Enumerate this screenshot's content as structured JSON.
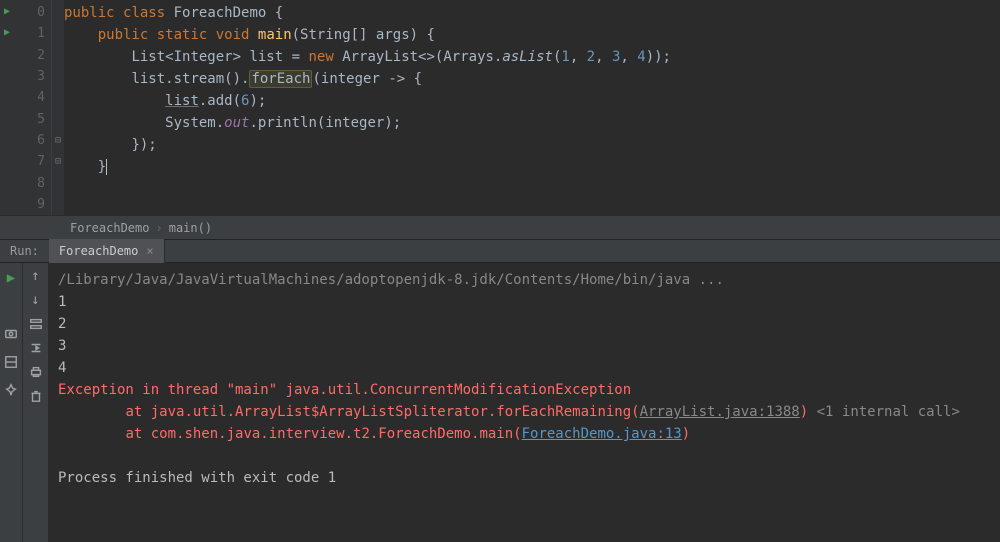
{
  "editor": {
    "lineNumbers": [
      "0",
      "1",
      "2",
      "3",
      "4",
      "5",
      "6",
      "7",
      "8",
      "9"
    ],
    "foldMarks": [
      "",
      "",
      "",
      "",
      "",
      "",
      "⊟",
      "⊟",
      "",
      ""
    ],
    "runMarkers": [
      true,
      true,
      false,
      false,
      false,
      false,
      false,
      false,
      false,
      false
    ]
  },
  "code": {
    "l0": {
      "kw1": "public",
      "kw2": "class",
      "name": "ForeachDemo",
      "brace": " {"
    },
    "l1": {
      "kw1": "public",
      "kw2": "static",
      "kw3": "void",
      "fn": "main",
      "params": "(String[] args) {"
    },
    "l2": {
      "type1": "List<Integer>",
      "var": "list",
      "assign": " = ",
      "kw": "new",
      "ctor": "ArrayList<>",
      "open": "(Arrays.",
      "asList": "asList",
      "args_open": "(",
      "n1": "1",
      "c": ", ",
      "n2": "2",
      "n3": "3",
      "n4": "4",
      "close": "));"
    },
    "l3": {
      "pre": "list.stream().",
      "box": "forEach",
      "post": "(integer -> {"
    },
    "l4": {
      "ul": "list",
      "call": ".add(",
      "n": "6",
      "post": ");"
    },
    "l5": {
      "pre": "System.",
      "it": "out",
      "call": ".println(integer);"
    },
    "l6": {
      "txt": "});"
    },
    "l7": {
      "txt": "}"
    }
  },
  "breadcrumb": {
    "a": "ForeachDemo",
    "b": "main()"
  },
  "run": {
    "label": "Run:",
    "tab": "ForeachDemo",
    "cmd": "/Library/Java/JavaVirtualMachines/adoptopenjdk-8.jdk/Contents/Home/bin/java ...",
    "out1": "1",
    "out2": "2",
    "out3": "3",
    "out4": "4",
    "err1": "Exception in thread \"main\" java.util.ConcurrentModificationException",
    "err2": "\tat java.util.ArrayList$ArrayListSpliterator.forEachRemaining(",
    "link1": "ArrayList.java:1388",
    "err2b": ") ",
    "hint": "<1 internal call>",
    "err3": "\tat com.shen.java.interview.t2.ForeachDemo.main(",
    "link2": "ForeachDemo.java:13",
    "err3b": ")",
    "exit": "Process finished with exit code 1"
  }
}
